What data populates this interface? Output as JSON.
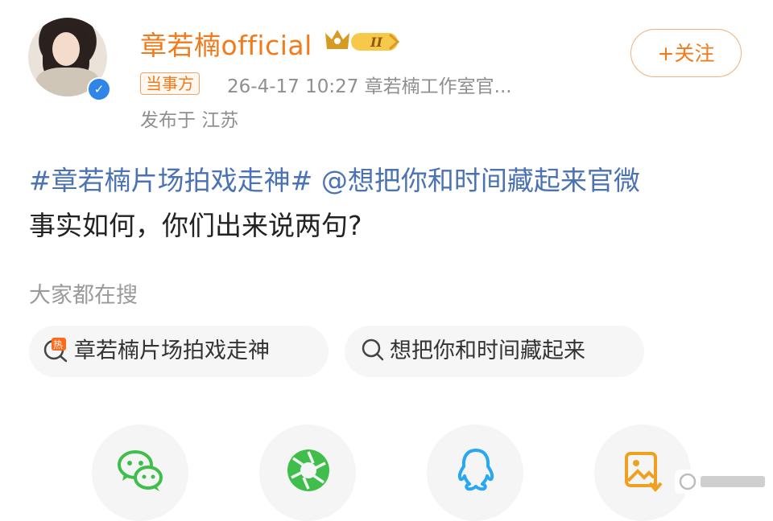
{
  "header": {
    "username": "章若楠official",
    "tag": "当事方",
    "meta": "26-4-17 10:27  章若楠工作室官...",
    "location": "发布于 江苏",
    "follow_label": "+关注"
  },
  "post": {
    "hashtag": "#章若楠片场拍戏走神#",
    "mention": "@想把你和时间藏起来官微",
    "body": "事实如何，你们出来说两句?"
  },
  "search": {
    "title": "大家都在搜",
    "items": [
      {
        "label": "章若楠片场拍戏走神",
        "icon": "hot-search-icon"
      },
      {
        "label": "想把你和时间藏起来",
        "icon": "search-icon"
      }
    ]
  },
  "share": {
    "items": [
      "wechat-icon",
      "moments-icon",
      "qq-icon",
      "save-image-icon"
    ]
  },
  "colors": {
    "accent": "#f27a1a",
    "link": "#4a72b4",
    "verified": "#2f86e8",
    "wechat": "#3fbe4b",
    "qq": "#29a7f0"
  }
}
